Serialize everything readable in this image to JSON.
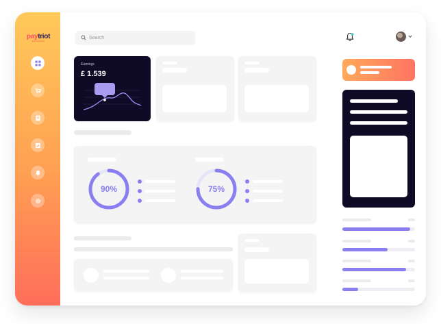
{
  "brand": {
    "logo_part1": "pay",
    "logo_part2": "triot",
    "logo_sub": "EXPENSES"
  },
  "sidebar": {
    "items": [
      {
        "icon": "grid-icon",
        "active": true
      },
      {
        "icon": "cart-icon",
        "active": false
      },
      {
        "icon": "document-icon",
        "active": false
      },
      {
        "icon": "checklist-icon",
        "active": false
      },
      {
        "icon": "bell-icon",
        "active": false
      },
      {
        "icon": "gear-icon",
        "active": false
      }
    ]
  },
  "search": {
    "placeholder": "Search"
  },
  "earnings": {
    "label": "Earnings",
    "value": "£ 1.539"
  },
  "stats": [
    {
      "percent": 90,
      "label": "90%"
    },
    {
      "percent": 75,
      "label": "75%"
    }
  ],
  "colors": {
    "accent": "#8a7ff0",
    "dark": "#0f0b26",
    "orange": "#ff9f52",
    "coral": "#ff6e5b"
  },
  "progress_bars": [
    0.93,
    0.62,
    0.88,
    0.22
  ]
}
